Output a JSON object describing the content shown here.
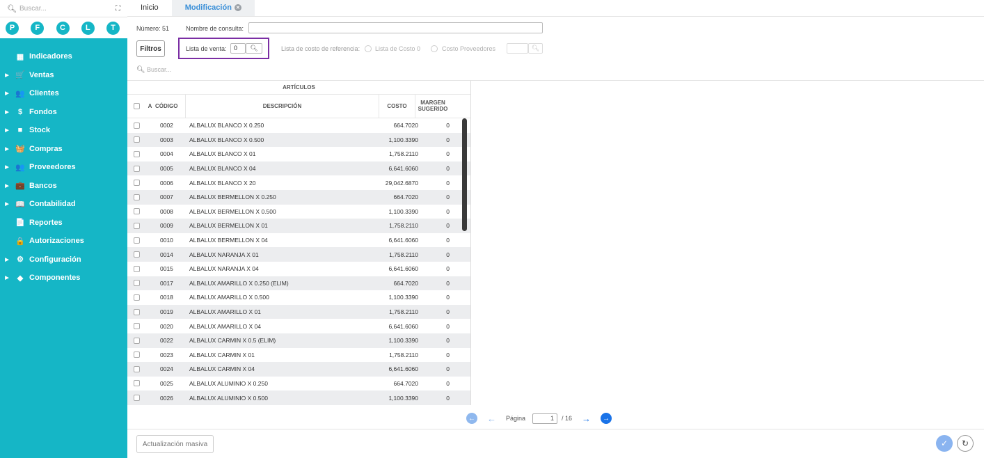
{
  "sidebar": {
    "search_placeholder": "Buscar...",
    "expand_icon": "expand-icon",
    "shortcuts": [
      "P",
      "F",
      "C",
      "L",
      "T"
    ],
    "items": [
      {
        "label": "Indicadores",
        "icon": "dashboard-icon",
        "glyph": "▦",
        "expandable": false
      },
      {
        "label": "Ventas",
        "icon": "cart-icon",
        "glyph": "🛒",
        "expandable": true
      },
      {
        "label": "Clientes",
        "icon": "users-icon",
        "glyph": "👥",
        "expandable": true
      },
      {
        "label": "Fondos",
        "icon": "dollar-icon",
        "glyph": "$",
        "expandable": true
      },
      {
        "label": "Stock",
        "icon": "box-icon",
        "glyph": "■",
        "expandable": true
      },
      {
        "label": "Compras",
        "icon": "basket-icon",
        "glyph": "🧺",
        "expandable": true
      },
      {
        "label": "Proveedores",
        "icon": "suppliers-icon",
        "glyph": "👥",
        "expandable": true
      },
      {
        "label": "Bancos",
        "icon": "briefcase-icon",
        "glyph": "💼",
        "expandable": true
      },
      {
        "label": "Contabilidad",
        "icon": "book-icon",
        "glyph": "📖",
        "expandable": true
      },
      {
        "label": "Reportes",
        "icon": "report-icon",
        "glyph": "📄",
        "expandable": false
      },
      {
        "label": "Autorizaciones",
        "icon": "lock-icon",
        "glyph": "🔒",
        "expandable": false
      },
      {
        "label": "Configuración",
        "icon": "gears-icon",
        "glyph": "⚙",
        "expandable": true
      },
      {
        "label": "Componentes",
        "icon": "puzzle-icon",
        "glyph": "◆",
        "expandable": true
      }
    ]
  },
  "tabs": [
    {
      "label": "Inicio"
    },
    {
      "label": "Modificación"
    }
  ],
  "form": {
    "numero_label": "Número: 51",
    "nombre_label": "Nombre de consulta:",
    "nombre_value": "",
    "filtros_label": "Filtros",
    "lista_venta_label": "Lista de venta:",
    "lista_venta_value": "0",
    "lista_costo_label": "Lista de costo de referencia:",
    "radio_costo0": "Lista de Costo 0",
    "radio_proveedores": "Costo Proveedores",
    "search_placeholder": "Buscar..."
  },
  "table": {
    "group_header": "ARTÍCULOS",
    "columns": {
      "a": "A",
      "codigo": "CÓDIGO",
      "descripcion": "DESCRIPCIÓN",
      "costo": "COSTO",
      "margen_1": "MARGEN",
      "margen_2": "SUGERIDO"
    },
    "rows": [
      {
        "codigo": "0002",
        "descripcion": "ALBALUX BLANCO X 0.250",
        "costo": "664.7020",
        "margen": "0"
      },
      {
        "codigo": "0003",
        "descripcion": "ALBALUX BLANCO X 0.500",
        "costo": "1,100.3390",
        "margen": "0"
      },
      {
        "codigo": "0004",
        "descripcion": "ALBALUX BLANCO X 01",
        "costo": "1,758.2110",
        "margen": "0"
      },
      {
        "codigo": "0005",
        "descripcion": "ALBALUX BLANCO X 04",
        "costo": "6,641.6060",
        "margen": "0"
      },
      {
        "codigo": "0006",
        "descripcion": "ALBALUX BLANCO X 20",
        "costo": "29,042.6870",
        "margen": "0"
      },
      {
        "codigo": "0007",
        "descripcion": "ALBALUX BERMELLON X 0.250",
        "costo": "664.7020",
        "margen": "0"
      },
      {
        "codigo": "0008",
        "descripcion": "ALBALUX BERMELLON X 0.500",
        "costo": "1,100.3390",
        "margen": "0"
      },
      {
        "codigo": "0009",
        "descripcion": "ALBALUX BERMELLON X 01",
        "costo": "1,758.2110",
        "margen": "0"
      },
      {
        "codigo": "0010",
        "descripcion": "ALBALUX BERMELLON X 04",
        "costo": "6,641.6060",
        "margen": "0"
      },
      {
        "codigo": "0014",
        "descripcion": "ALBALUX NARANJA X 01",
        "costo": "1,758.2110",
        "margen": "0"
      },
      {
        "codigo": "0015",
        "descripcion": "ALBALUX NARANJA X 04",
        "costo": "6,641.6060",
        "margen": "0"
      },
      {
        "codigo": "0017",
        "descripcion": "ALBALUX AMARILLO X 0.250 (ELIM)",
        "costo": "664.7020",
        "margen": "0"
      },
      {
        "codigo": "0018",
        "descripcion": "ALBALUX AMARILLO X 0.500",
        "costo": "1,100.3390",
        "margen": "0"
      },
      {
        "codigo": "0019",
        "descripcion": "ALBALUX AMARILLO X 01",
        "costo": "1,758.2110",
        "margen": "0"
      },
      {
        "codigo": "0020",
        "descripcion": "ALBALUX AMARILLO X 04",
        "costo": "6,641.6060",
        "margen": "0"
      },
      {
        "codigo": "0022",
        "descripcion": "ALBALUX CARMIN X 0.5 (ELIM)",
        "costo": "1,100.3390",
        "margen": "0"
      },
      {
        "codigo": "0023",
        "descripcion": "ALBALUX CARMIN X 01",
        "costo": "1,758.2110",
        "margen": "0"
      },
      {
        "codigo": "0024",
        "descripcion": "ALBALUX CARMIN X 04",
        "costo": "6,641.6060",
        "margen": "0"
      },
      {
        "codigo": "0025",
        "descripcion": "ALBALUX ALUMINIO X 0.250",
        "costo": "664.7020",
        "margen": "0"
      },
      {
        "codigo": "0026",
        "descripcion": "ALBALUX ALUMINIO X 0.500",
        "costo": "1,100.3390",
        "margen": "0"
      }
    ]
  },
  "pagination": {
    "label": "Página",
    "current": "1",
    "separator": "/ 16"
  },
  "footer": {
    "actualizacion_label": "Actualización masiva"
  },
  "colors": {
    "sidebar_bg": "#15b6c6",
    "accent_blue": "#1a73e8",
    "highlight_border": "#7b2ea4"
  }
}
